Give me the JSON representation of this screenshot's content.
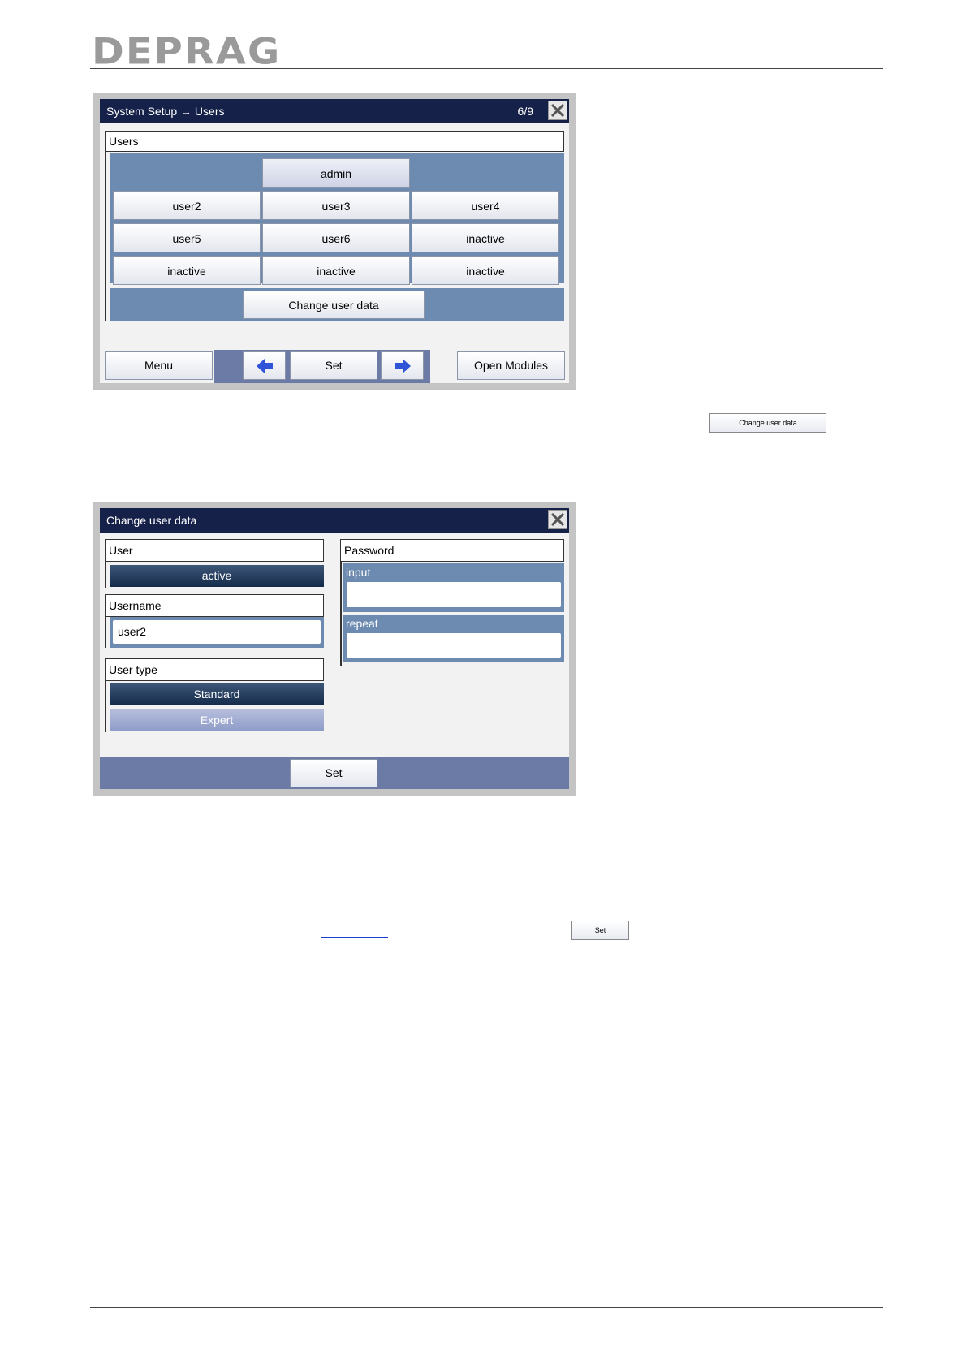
{
  "logo": "DEPRAG",
  "screen1": {
    "title": "System Setup → Users",
    "page": "6/9",
    "section": "Users",
    "admin": "admin",
    "users": [
      "user2",
      "user3",
      "user4",
      "user5",
      "user6",
      "inactive",
      "inactive",
      "inactive",
      "inactive"
    ],
    "change_button": "Change user data",
    "footer": {
      "menu": "Menu",
      "set": "Set",
      "open_modules": "Open Modules"
    }
  },
  "inline_change_button": "Change user data",
  "screen2": {
    "title": "Change user data",
    "user_label": "User",
    "user_status": "active",
    "username_label": "Username",
    "username_value": "user2",
    "user_type_label": "User type",
    "type_standard": "Standard",
    "type_expert": "Expert",
    "password_label": "Password",
    "input_label": "input",
    "repeat_label": "repeat",
    "set_button": "Set"
  },
  "inline_set_button": "Set",
  "colors": {
    "titlebar": "#16214a",
    "panel": "#6d8bb0",
    "footer": "#6b7ba6",
    "link": "#1a3fd0"
  }
}
